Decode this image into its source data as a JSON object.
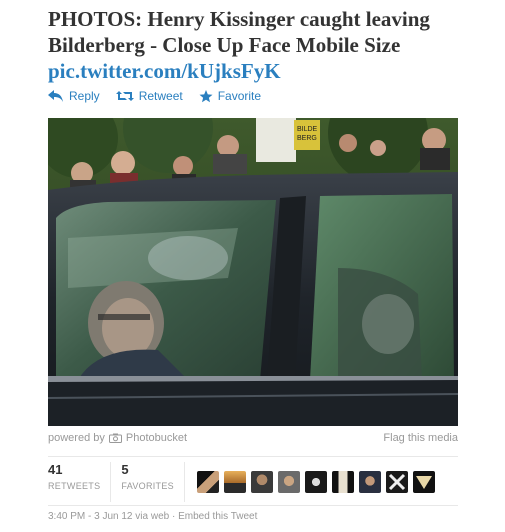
{
  "tweet": {
    "text": "PHOTOS: Henry Kissinger caught leaving Bilderberg - Close Up Face Mobile Size",
    "link": "pic.twitter.com/kUjksFyK"
  },
  "actions": {
    "reply": "Reply",
    "retweet": "Retweet",
    "favorite": "Favorite"
  },
  "photo": {
    "sign_text": "BILDE\nBERG"
  },
  "media_footer": {
    "powered_by": "powered by",
    "provider": "Photobucket",
    "flag": "Flag this media"
  },
  "stats": {
    "retweets_count": "41",
    "retweets_label": "RETWEETS",
    "favorites_count": "5",
    "favorites_label": "FAVORITES"
  },
  "meta": {
    "time": "3:40 PM - 3 Jun 12",
    "via": "via web",
    "separator": "·",
    "embed": "Embed this Tweet"
  },
  "colors": {
    "link": "#2a7fbf",
    "muted": "#999999",
    "text": "#333333"
  }
}
